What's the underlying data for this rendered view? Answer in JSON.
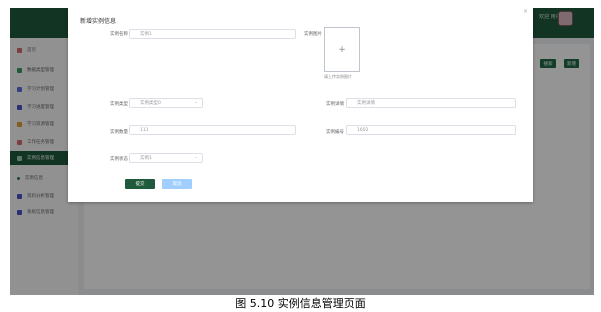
{
  "topbar": {
    "user_name": "欢迎 用户"
  },
  "sidebar": {
    "items": [
      {
        "label": "首页",
        "icon": "home-icon",
        "color": "#d66b6b"
      },
      {
        "label": "数据类型管理",
        "icon": "database-icon",
        "color": "#3a9a6a"
      },
      {
        "label": "学习计划管理",
        "icon": "calendar-icon",
        "color": "#5b6ee0"
      },
      {
        "label": "学习进度管理",
        "icon": "progress-icon",
        "color": "#4a52c8"
      },
      {
        "label": "学习资源管理",
        "icon": "folder-icon",
        "color": "#e0a030"
      },
      {
        "label": "工作任务管理",
        "icon": "briefcase-icon",
        "color": "#d66b6b"
      },
      {
        "label": "实例信息管理",
        "icon": "instance-icon",
        "color": "#9fd0b2"
      },
      {
        "label": "实例信息",
        "icon": "dot-icon",
        "color": "#3a7a55"
      },
      {
        "label": "资料分析管理",
        "icon": "chart-icon",
        "color": "#4a52c8"
      },
      {
        "label": "系统信息管理",
        "icon": "settings-icon",
        "color": "#4a52c8"
      }
    ]
  },
  "main": {
    "search_button": "搜索",
    "add_button": "新增"
  },
  "dialog": {
    "title": "新增实例信息",
    "close": "×",
    "name_label": "实例名称",
    "name_value": "实例1",
    "image_label": "实例图片",
    "upload_plus": "+",
    "upload_tip": "请上传实例图片",
    "type_label": "实例类型",
    "type_value": "实例类型0",
    "detail_label": "实例详情",
    "detail_placeholder": "实例详情",
    "count_label": "实例数量",
    "count_value": "111",
    "code_label": "实例编号",
    "code_value": "1602",
    "status_label": "实例状态",
    "status_value": "实例1",
    "submit_button": "提交",
    "cancel_button": "取消"
  },
  "caption": "图 5.10  实例信息管理页面"
}
